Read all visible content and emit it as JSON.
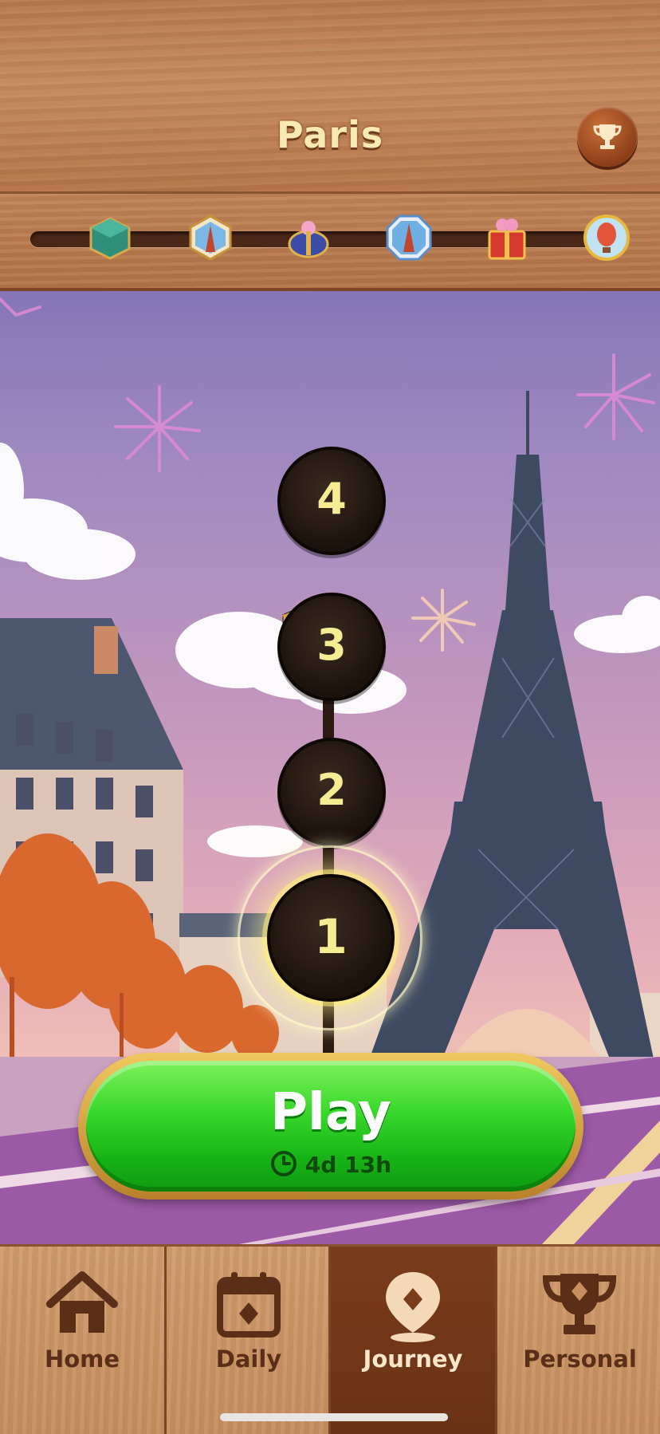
{
  "header": {
    "title": "Paris",
    "trophy_icon": "trophy-icon"
  },
  "progress_milestones": [
    "chest-icon",
    "eiffel-badge-icon",
    "gift-box-icon",
    "eiffel-badge-icon",
    "present-icon",
    "balloon-badge-icon"
  ],
  "levels": [
    {
      "number": "4",
      "state": "locked"
    },
    {
      "number": "3",
      "state": "locked"
    },
    {
      "number": "2",
      "state": "locked"
    },
    {
      "number": "1",
      "state": "current"
    }
  ],
  "play_button": {
    "label": "Play",
    "timer": "4d 13h"
  },
  "nav": [
    {
      "label": "Home",
      "icon": "home-icon",
      "active": false
    },
    {
      "label": "Daily",
      "icon": "calendar-icon",
      "active": false
    },
    {
      "label": "Journey",
      "icon": "map-pin-icon",
      "active": true
    },
    {
      "label": "Personal",
      "icon": "trophy-icon",
      "active": false
    }
  ],
  "colors": {
    "accent_green": "#2fce25",
    "wood": "#c48a5c",
    "level_text": "#f6ec93"
  }
}
